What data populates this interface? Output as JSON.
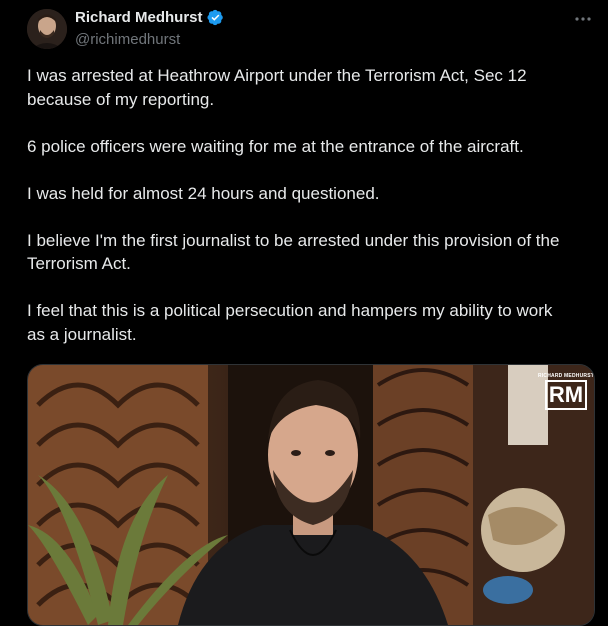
{
  "author": {
    "display_name": "Richard Medhurst",
    "handle": "@richimedhurst",
    "verified": true
  },
  "icons": {
    "avatar": "avatar-photo",
    "verified": "verified-badge-icon",
    "more": "more-options-icon"
  },
  "colors": {
    "verified_blue": "#1d9bf0",
    "handle_gray": "#71767b",
    "text": "#e7e9ea",
    "background": "#000000"
  },
  "tweet": {
    "text": "I was arrested at Heathrow Airport under the Terrorism Act, Sec 12\nbecause of my reporting.\n\n6 police officers were waiting for me at the entrance of the aircraft.\n\nI was held for almost 24 hours and questioned.\n\nI believe I'm the first journalist to be arrested under this provision of the\nTerrorism Act.\n\nI feel that this is a political persecution and hampers my ability to work\nas a journalist."
  },
  "media": {
    "watermark_small": "RICHARD MEDHURST",
    "watermark_big": "RM"
  }
}
